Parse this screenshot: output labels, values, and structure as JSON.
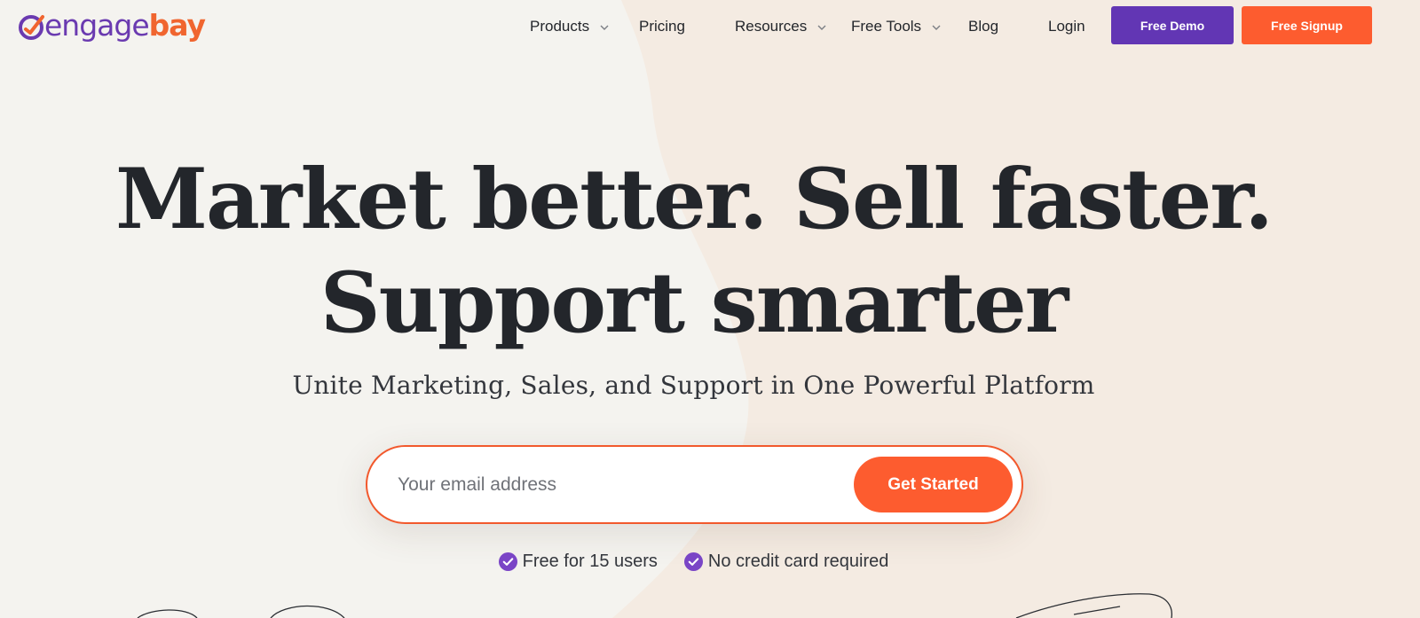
{
  "brand": {
    "name_part1": "engage",
    "name_part2": "bay",
    "logo_icon": "engagebay-logo-icon",
    "primary_color": "#6236b4",
    "accent_color": "#fd5c2f"
  },
  "nav": {
    "items": [
      {
        "label": "Products",
        "has_dropdown": true
      },
      {
        "label": "Pricing",
        "has_dropdown": false
      },
      {
        "label": "Resources",
        "has_dropdown": true
      },
      {
        "label": "Free Tools",
        "has_dropdown": true
      },
      {
        "label": "Blog",
        "has_dropdown": false
      },
      {
        "label": "Login",
        "has_dropdown": false
      }
    ],
    "demo_label": "Free Demo",
    "signup_label": "Free Signup"
  },
  "hero": {
    "title_line1": "Market better. Sell faster.",
    "title_line2": "Support smarter",
    "subtitle": "Unite Marketing, Sales, and Support in One Powerful Platform"
  },
  "signup_form": {
    "email_placeholder": "Your email address",
    "email_value": "",
    "submit_label": "Get Started"
  },
  "perks": [
    {
      "label": "Free for 15 users",
      "icon": "check-circle-icon"
    },
    {
      "label": "No credit card required",
      "icon": "check-circle-icon"
    }
  ]
}
